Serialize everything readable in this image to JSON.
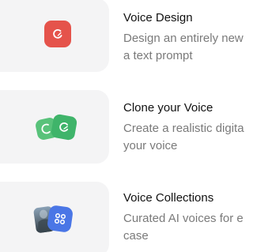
{
  "items": [
    {
      "title": "Voice Design",
      "desc_line1": "Design an entirely new",
      "desc_line2": "a text prompt",
      "icon": "voice-design-icon",
      "accent": "#e5534b"
    },
    {
      "title": "Clone your Voice",
      "desc_line1": "Create a realistic digita",
      "desc_line2": "your voice",
      "icon": "clone-voice-icon",
      "accent": "#3fb46a"
    },
    {
      "title": "Voice Collections",
      "desc_line1": "Curated AI voices for e",
      "desc_line2": "case",
      "icon": "voice-collections-icon",
      "accent": "#4a76e6"
    }
  ]
}
